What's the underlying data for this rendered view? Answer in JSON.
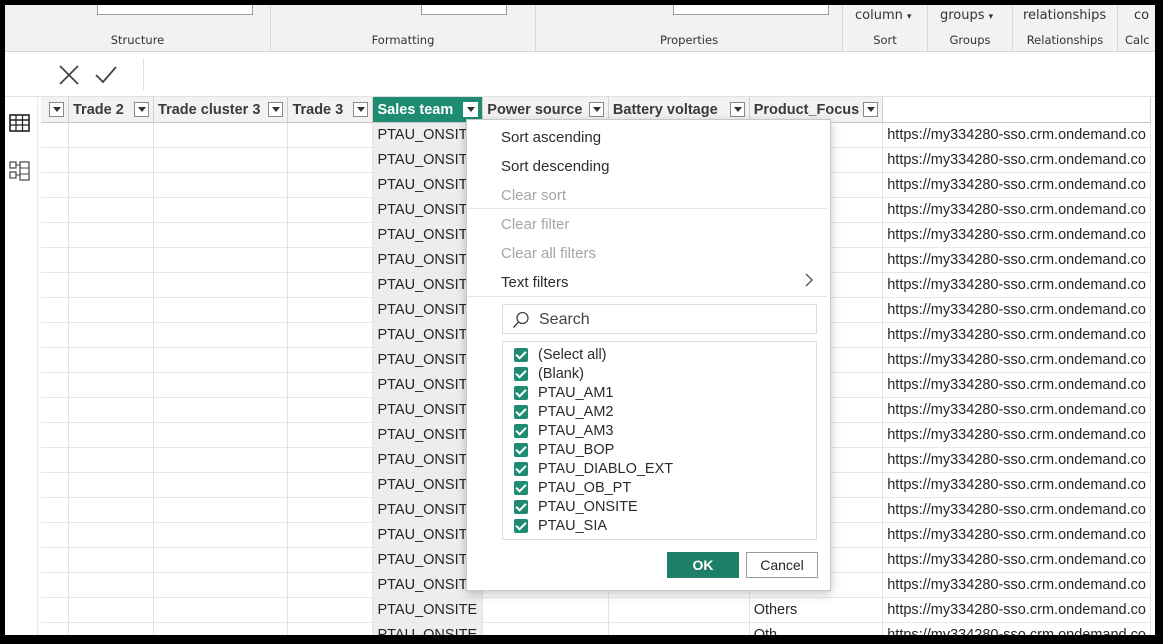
{
  "ribbon": {
    "groups": [
      {
        "label": "Structure"
      },
      {
        "label": "Formatting"
      },
      {
        "label": "Properties"
      },
      {
        "label": "Sort",
        "button": "column"
      },
      {
        "label": "Groups",
        "button": "groups"
      },
      {
        "label": "Relationships",
        "button": "relationships"
      },
      {
        "label": "Calc",
        "button": "co"
      }
    ]
  },
  "table": {
    "columns": [
      "",
      "Trade 2",
      "Trade cluster 3",
      "Trade 3",
      "Sales team",
      "Power source",
      "Battery voltage",
      "Product_Focus",
      ""
    ],
    "sales_team_value": "PTAU_ONSITE",
    "sales_team_truncated": "PTAU_ONSITI",
    "url_value": "https://my334280-sso.crm.ondemand.co",
    "product_focus_value": "Others",
    "product_focus_partial": "Oth",
    "partial_row_sales": "PTAU_ONSITE"
  },
  "filter_menu": {
    "sort_ascending": "Sort ascending",
    "sort_descending": "Sort descending",
    "clear_sort": "Clear sort",
    "clear_filter": "Clear filter",
    "clear_all_filters": "Clear all filters",
    "text_filters": "Text filters",
    "search_placeholder": "Search",
    "options": [
      "(Select all)",
      "(Blank)",
      "PTAU_AM1",
      "PTAU_AM2",
      "PTAU_AM3",
      "PTAU_BOP",
      "PTAU_DIABLO_EXT",
      "PTAU_OB_PT",
      "PTAU_ONSITE",
      "PTAU_SIA"
    ],
    "ok_label": "OK",
    "cancel_label": "Cancel"
  },
  "colors": {
    "accent": "#1e8c72",
    "ok_button": "#1e7f68"
  },
  "icons": {
    "commit": "checkmark-icon",
    "discard": "close-icon",
    "report_view": "bar-chart-icon",
    "table_view": "table-grid-icon",
    "model_view": "model-icon"
  }
}
